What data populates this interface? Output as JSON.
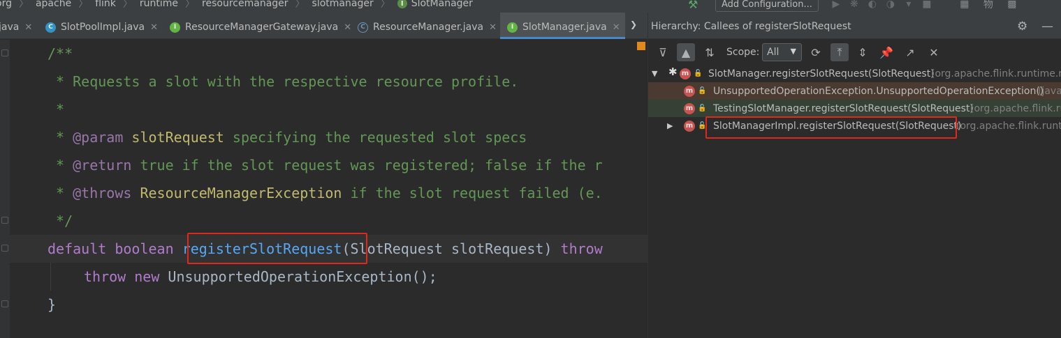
{
  "breadcrumb": {
    "items": [
      "org",
      "apache",
      "flink",
      "runtime",
      "resourcemanager",
      "slotmanager",
      "SlotManager"
    ],
    "separator": "〉"
  },
  "toolbar": {
    "add_configuration": "Add Configuration..."
  },
  "editor_tabs": [
    {
      "label": "java",
      "icon": "none"
    },
    {
      "label": "SlotPoolImpl.java",
      "icon": "class-icon"
    },
    {
      "label": "ResourceManagerGateway.java",
      "icon": "interface-icon"
    },
    {
      "label": "ResourceManager.java",
      "icon": "abstract-class-icon"
    },
    {
      "label": "SlotManager.java",
      "icon": "interface-icon",
      "active": true
    }
  ],
  "tab_close": "✕",
  "code": {
    "l1": "/**",
    "l2": " * Requests a slot with the respective resource profile.",
    "l3": " *",
    "l4_star": " * ",
    "l4_tag": "@param",
    "l4_name": "slotRequest",
    "l4_rest": " specifying the requested slot specs",
    "l5_star": " * ",
    "l5_tag": "@return",
    "l5_rest": " true if the slot request was registered; false if the r",
    "l6_star": " * ",
    "l6_tag": "@throws",
    "l6_type": "ResourceManagerException",
    "l6_rest": " if the slot request failed (e.",
    "l7": " */",
    "l8_kw1": "default",
    "l8_kw2": "boolean",
    "l8_fn": "registerSlotRequest",
    "l8_args": "(SlotRequest slotRequest) ",
    "l8_throw": "throw",
    "l9_kw1": "throw",
    "l9_kw2": "new",
    "l9_rest": " UnsupportedOperationException();",
    "l10": "}"
  },
  "hierarchy": {
    "title": "Hierarchy:  Callees of registerSlotRequest",
    "scope_label": "Scope:",
    "scope_value": "All",
    "rows": [
      {
        "name": "SlotManager.registerSlotRequest(SlotRequest)",
        "pkg": "(org.apache.flink.runtime.re",
        "state": "root"
      },
      {
        "name": "UnsupportedOperationException.UnsupportedOperationException()",
        "pkg": "(java",
        "state": "error"
      },
      {
        "name": "TestingSlotManager.registerSlotRequest(SlotRequest)",
        "pkg": "(org.apache.flink.ru",
        "state": "ok"
      },
      {
        "name": "SlotManagerImpl.registerSlotRequest(SlotRequest)",
        "pkg": "(org.apache.flink.runti",
        "state": "collapsed"
      }
    ]
  },
  "colors": {
    "highlight_box": "#e0291d",
    "active_tab_underline": "#4a88c7",
    "method_badge": "#c75450"
  }
}
